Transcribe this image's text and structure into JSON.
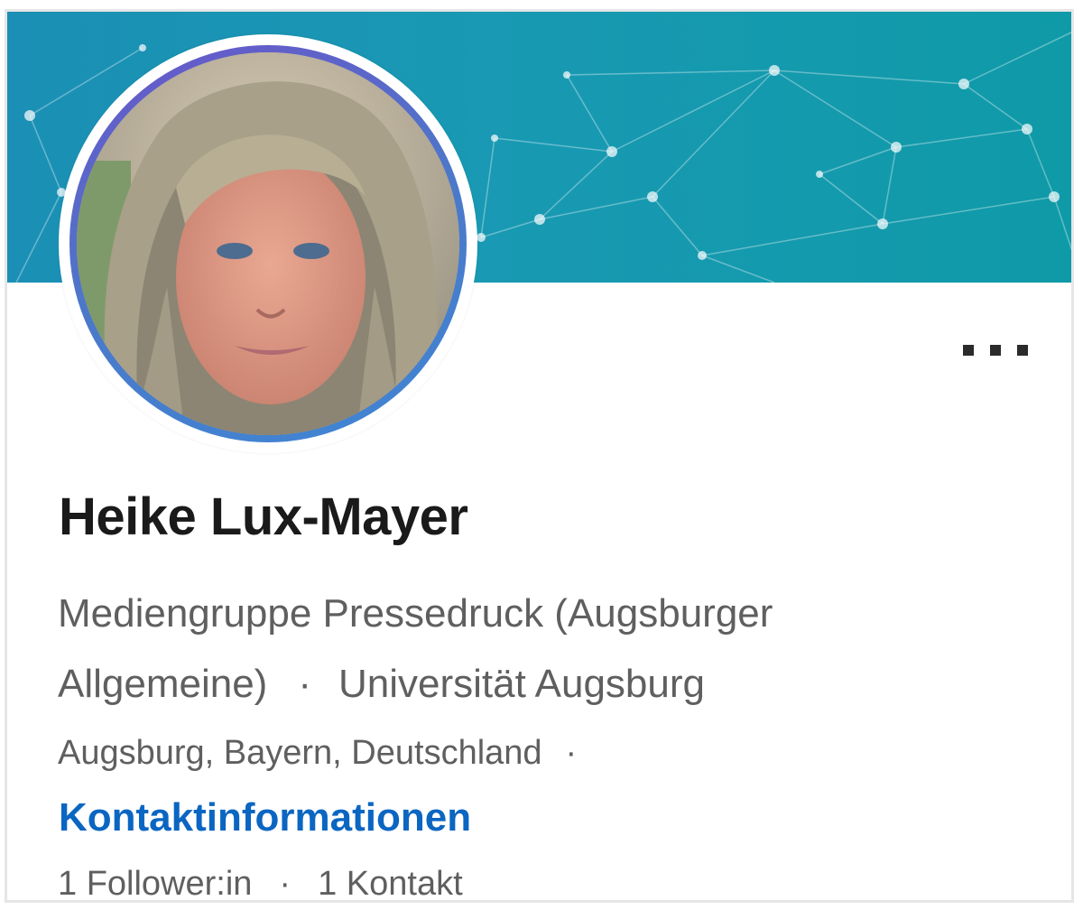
{
  "profile": {
    "name": "Heike Lux-Mayer",
    "headline_line1": "Mediengruppe Pressedruck (Augsburger",
    "headline_company": "Allgemeine)",
    "headline_separator": "·",
    "headline_school": "Universität Augsburg",
    "location": "Augsburg, Bayern, Deutschland",
    "location_separator": "·",
    "contact_info_label": "Kontaktinformationen",
    "followers": "1 Follower:in",
    "stats_separator": "·",
    "connections": "1 Kontakt"
  },
  "actions": {
    "more_icon": "more-horizontal-icon"
  },
  "colors": {
    "banner": "#1a96b2",
    "link": "#0b66c2",
    "avatar_ring": "#5266c9",
    "text_secondary": "#5f5f5f"
  }
}
